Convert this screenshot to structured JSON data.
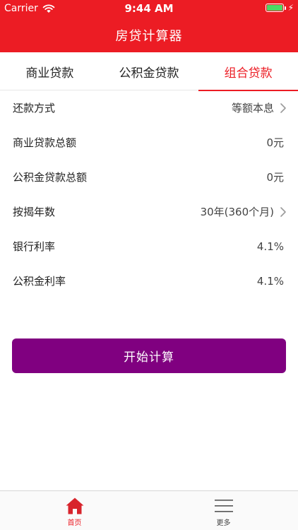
{
  "status_bar": {
    "carrier": "Carrier",
    "time": "9:44 AM",
    "bolt": "⚡"
  },
  "nav": {
    "title": "房贷计算器",
    "background_color": "#ec1c24"
  },
  "tabs": [
    {
      "label": "商业贷款",
      "active": false
    },
    {
      "label": "公积金贷款",
      "active": false
    },
    {
      "label": "组合贷款",
      "active": true
    }
  ],
  "form": {
    "rows": [
      {
        "label": "还款方式",
        "value": "等额本息",
        "chevron": true
      },
      {
        "label": "商业贷款总额",
        "value": "0元",
        "chevron": false
      },
      {
        "label": "公积金贷款总额",
        "value": "0元",
        "chevron": false
      },
      {
        "label": "按揭年数",
        "value": "30年(360个月)",
        "chevron": true
      },
      {
        "label": "银行利率",
        "value": "4.1%",
        "chevron": false
      },
      {
        "label": "公积金利率",
        "value": "4.1%",
        "chevron": false
      }
    ]
  },
  "action": {
    "start_label": "开始计算",
    "color": "#800080"
  },
  "tab_bar": {
    "items": [
      {
        "label": "首页",
        "icon": "home-icon",
        "active": true
      },
      {
        "label": "更多",
        "icon": "menu-icon",
        "active": false
      }
    ]
  },
  "colors": {
    "accent": "#ec1c24",
    "battery": "#4cd964"
  }
}
